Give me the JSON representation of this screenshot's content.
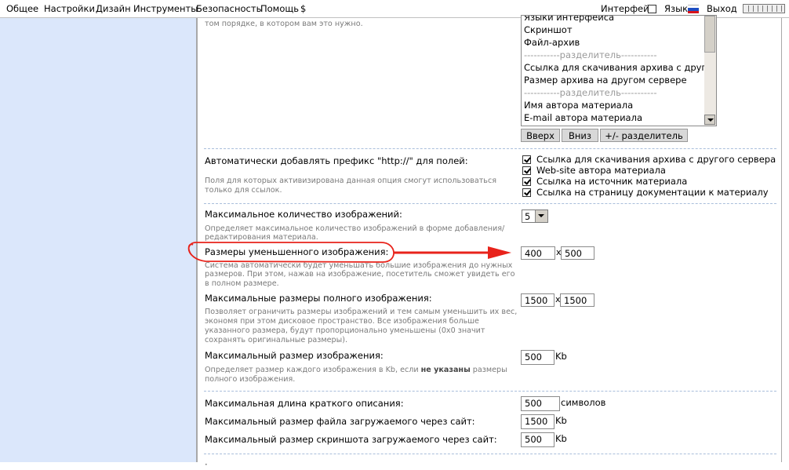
{
  "menu": {
    "items": [
      "Общее",
      "Настройки",
      "Дизайн",
      "Инструменты",
      "Безопасность",
      "Помощь",
      "$"
    ],
    "interface_label": "Интерфейс",
    "language_label": "Язык",
    "logout_label": "Выход"
  },
  "top_section": {
    "desc_fragment": "том порядке, в котором вам это нужно.",
    "list_items": [
      "Языки интерфейса",
      "Скриншот",
      "Файл-архив",
      "-----------разделитель-----------",
      "Ссылка для скачивания архива с другого",
      "Размер архива на другом сервере",
      "-----------разделитель-----------",
      "Имя автора материала",
      "E-mail автора материала"
    ],
    "buttons": {
      "up": "Вверх",
      "down": "Вниз",
      "separator": "+/- разделитель"
    }
  },
  "http_prefix": {
    "label": "Автоматически добавлять префикс \"http://\" для полей:",
    "desc_line1": "Поля для которых активизирована данная опция смогут использоваться",
    "desc_line2": "только для ссылок.",
    "options": [
      "Ссылка для скачивания архива с другого сервера",
      "Web-site автора материала",
      "Ссылка на источник материала",
      "Ссылка на страницу документации к материалу"
    ]
  },
  "max_images": {
    "label": "Максимальное количество изображений:",
    "desc_line1": "Определяет максимальное количество изображений в форме добавления/",
    "desc_line2": "редактирования материала.",
    "value": "5"
  },
  "thumb_size": {
    "label": "Размеры уменьшенного изображения:",
    "desc_line1": "Система автоматически будет уменьшать большие изображения до нужных",
    "desc_line2": "размеров. При этом, нажав на изображение, посетитель сможет увидеть его",
    "desc_line3": "в полном размере.",
    "width": "400",
    "sep": "x",
    "height": "500"
  },
  "full_size": {
    "label": "Максимальные размеры полного изображения:",
    "desc_line1": "Позволяет ограничить размеры изображений и тем самым уменьшить их вес,",
    "desc_line2": "экономя при этом дисковое пространство. Все изображения больше",
    "desc_line3": "указанного размера, будут пропорционально уменьшены (0x0 значит",
    "desc_line4": "сохранять оригинальные размеры).",
    "width": "1500",
    "sep": "x",
    "height": "1500"
  },
  "max_img_file": {
    "label": "Максимальный размер изображения:",
    "desc_line1_a": "Определяет размер каждого изображения в Kb, если ",
    "desc_line1_b": "не указаны",
    "desc_line1_c": " размеры",
    "desc_line2": "полного изображения.",
    "value": "500",
    "unit": "Kb"
  },
  "max_desc": {
    "label": "Максимальная длина краткого описания:",
    "value": "500",
    "unit": "символов"
  },
  "max_file_upload": {
    "label": "Максимальный размер файла загружаемого через сайт:",
    "value": "1500",
    "unit": "Kb"
  },
  "max_screenshot": {
    "label": "Максимальный размер скриншота загружаемого через сайт:",
    "value": "500",
    "unit": "Kb"
  },
  "colors": {
    "annotation_red": "#e8231b",
    "left_panel": "#dbe7fb"
  },
  "icons": [
    "russian-flag-icon",
    "checkbox-icon",
    "scroll-down-arrow-icon",
    "dropdown-arrow-icon",
    "red-arrow-annotation"
  ]
}
